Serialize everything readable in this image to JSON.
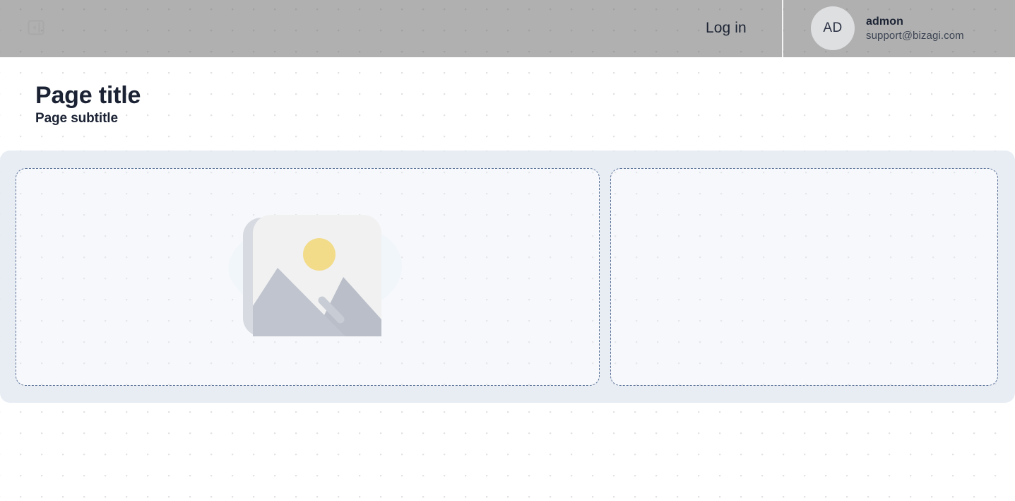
{
  "header": {
    "collapse_icon": "collapse-sidebar-icon",
    "login_label": "Log in",
    "user": {
      "initials": "AD",
      "name": "admon",
      "email": "support@bizagi.com"
    },
    "bar_color": "#8a8a8a",
    "divider_color": "#ffffff"
  },
  "page": {
    "title": "Page title",
    "subtitle": "Page subtitle"
  },
  "canvas": {
    "container_color": "#e8edf4",
    "panel_color": "#f6f8fb",
    "panel_border_color": "#5a7298",
    "dot_color": "#e2e2e4",
    "panels": [
      {
        "name": "left-drop-panel",
        "content": "image-placeholder",
        "label": ""
      },
      {
        "name": "right-drop-panel",
        "content": "empty",
        "label": ""
      }
    ]
  },
  "image_placeholder": {
    "icon": "image-placeholder-icon",
    "frame_color": "#f0f0f0",
    "frame_shadow_color": "#dcdee2",
    "mountain_color": "#b9bec9",
    "mountain_shadow_color": "#c8ccd4",
    "sun_color": "#f2dc89",
    "blob_color": "#f0f5fa"
  }
}
